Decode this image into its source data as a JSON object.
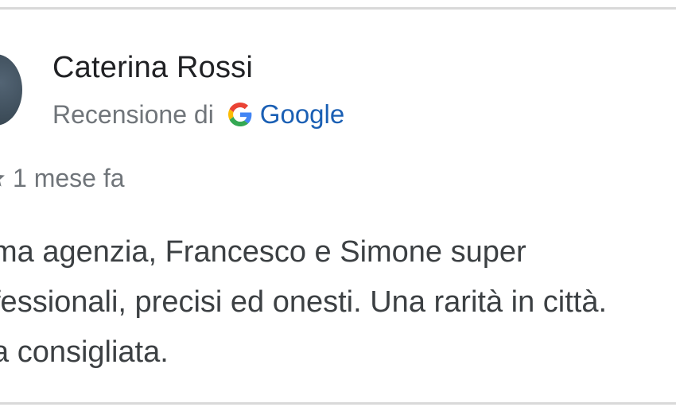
{
  "review": {
    "author_name": "Caterina Rossi",
    "source_label": "Recensione di",
    "source_name": "Google",
    "time_ago": "1 mese fa",
    "text_lines": [
      "ma agenzia, Francesco e Simone super",
      "fessionali, precisi ed onesti. Una rarità in città.",
      "a consigliata."
    ]
  },
  "icons": {
    "google_logo": "google-g-icon",
    "rating_star": "star-icon"
  },
  "colors": {
    "author_text": "#202124",
    "secondary_text": "#70757a",
    "google_link": "#1a5fb4",
    "body_text": "#3c4043",
    "divider": "#d9d9d9",
    "avatar": "#3f4f5c"
  }
}
